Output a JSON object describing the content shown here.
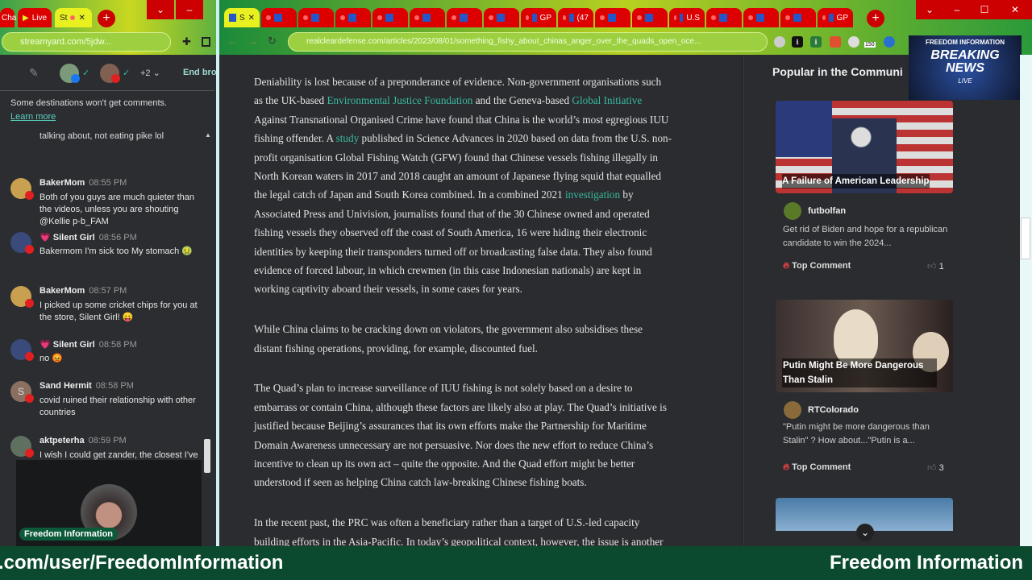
{
  "left_browser": {
    "tabs": [
      {
        "label": "Cha"
      },
      {
        "label": "Live"
      },
      {
        "label": "St"
      }
    ],
    "url": "streamyard.com/5jdw...",
    "toolbar": {
      "destinations_more": "+2",
      "end_broadcast": "End bro"
    }
  },
  "chat": {
    "notice": "Some destinations won't get comments.",
    "learn_more": "Learn more",
    "truncated_top": "talking about, not eating pike lol",
    "messages": [
      {
        "name": "BakerMom",
        "time": "08:55 PM",
        "text": "Both of you guys are much quieter than the videos, unless you are shouting @Kellie p-b_FAM",
        "avatar_color": "#c8a050"
      },
      {
        "name": "💗 Silent Girl",
        "time": "08:56 PM",
        "text": "Bakermom I'm sick too My stomach 🤢",
        "avatar_color": "#3a4a7a"
      },
      {
        "name": "BakerMom",
        "time": "08:57 PM",
        "text": "I picked up some cricket chips for you at the store, Silent Girl! 😛",
        "avatar_color": "#c8a050"
      },
      {
        "name": "💗 Silent Girl",
        "time": "08:58 PM",
        "text": "no 😡",
        "avatar_color": "#3a4a7a"
      },
      {
        "name": "Sand Hermit",
        "time": "08:58 PM",
        "text": "covid ruined their relationship with other countries",
        "avatar_color": "#8a7060",
        "initial": "S"
      },
      {
        "name": "aktpeterha",
        "time": "08:59 PM",
        "text": "I wish I could get zander, the closest I've come to them is looking at my",
        "avatar_color": "#607060"
      }
    ],
    "webcam_label": "Freedom Information"
  },
  "right_browser": {
    "tabs": [
      "S",
      "",
      "",
      "",
      "",
      "",
      "",
      "",
      "GP",
      "(47",
      "",
      "",
      "U.S",
      "",
      "",
      "",
      "GP"
    ],
    "url": "realcleardefense.com/articles/2023/08/01/something_fishy_about_chinas_anger_over_the_quads_open_oce...",
    "extension_badge": "150",
    "window_controls": [
      "⌄",
      "–",
      "☐",
      "✕"
    ]
  },
  "article": {
    "paragraphs": [
      [
        [
          {
            "t": "Deniability is lost because of a preponderance of evidence. Non-government organisations such"
          }
        ],
        [
          {
            "t": "as the UK-based "
          },
          {
            "t": "Environmental Justice Foundation",
            "link": true
          },
          {
            "t": " and the Geneva-based "
          },
          {
            "t": "Global Initiative",
            "link": true
          }
        ],
        [
          {
            "t": "Against Transnational Organised Crime have found that China is the world’s most egregious IUU"
          }
        ],
        [
          {
            "t": "fishing offender. A "
          },
          {
            "t": "study",
            "link": true
          },
          {
            "t": " published in Science Advances in 2020 based on data from the U.S. non-"
          }
        ],
        [
          {
            "t": "profit organisation Global Fishing Watch (GFW) found that Chinese vessels fishing illegally in"
          }
        ],
        [
          {
            "t": "North Korean waters in 2017 and 2018 caught an amount of Japanese flying squid that equalled"
          }
        ],
        [
          {
            "t": "the legal catch of Japan and South Korea combined. In a combined 2021 "
          },
          {
            "t": "investigation",
            "link": true
          },
          {
            "t": " by"
          }
        ],
        [
          {
            "t": "Associated Press and Univision, journalists found that of the 30 Chinese owned and operated"
          }
        ],
        [
          {
            "t": "fishing vessels they observed off the coast of South America, 16 were hiding their electronic"
          }
        ],
        [
          {
            "t": "identities by keeping their transponders turned off or broadcasting false data. They also found"
          }
        ],
        [
          {
            "t": "evidence of forced labour, in which crewmen (in this case Indonesian nationals) are kept in"
          }
        ],
        [
          {
            "t": "working captivity aboard their vessels, in some cases for years."
          }
        ]
      ],
      [
        [
          {
            "t": "While China claims to be cracking down on violators, the government also subsidises these"
          }
        ],
        [
          {
            "t": "distant fishing operations, providing, for example, discounted fuel."
          }
        ]
      ],
      [
        [
          {
            "t": "The Quad’s plan to increase surveillance of IUU fishing is not solely based on a desire to"
          }
        ],
        [
          {
            "t": "embarrass or contain China, although these factors are likely also at play. The Quad’s initiative is"
          }
        ],
        [
          {
            "t": "justified because Beijing’s assurances that its own efforts make the Partnership for Maritime"
          }
        ],
        [
          {
            "t": "Domain Awareness unnecessary are not persuasive. Nor does the new effort to reduce China’s"
          }
        ],
        [
          {
            "t": "incentive to clean up its own act – quite the opposite. And the Quad effort might be better"
          }
        ],
        [
          {
            "t": "understood if seen as helping China catch law-breaking Chinese fishing boats."
          }
        ]
      ],
      [
        [
          {
            "t": "In the recent past, the PRC was often a beneficiary rather than a target of U.S.-led capacity"
          }
        ],
        [
          {
            "t": "building efforts in the Asia-Pacific. In today’s geopolitical context, however, the issue is another"
          }
        ]
      ]
    ]
  },
  "sidebar": {
    "heading": "Popular in the Communi",
    "overlay": {
      "top": "FREEDOM INFORMATION",
      "main1": "BREAKING",
      "main2": "NEWS",
      "sub": "LIVE"
    },
    "cards": [
      {
        "title": "A Failure of American Leadership",
        "user": "futbolfan",
        "comment": "Get rid of Biden and hope for a republican candidate to win the 2024...",
        "tag": "Top Comment",
        "likes": "1"
      },
      {
        "title": "Putin Might Be More Dangerous Than Stalin",
        "user": "RTColorado",
        "comment": "\"Putin might be more dangerous than Stalin\" ? How about...\"Putin is a...",
        "tag": "Top Comment",
        "likes": "3"
      }
    ]
  },
  "banner": {
    "left": ".com/user/FreedomInformation",
    "right": "Freedom Information"
  },
  "colors": {
    "link": "#3ab8a0",
    "banner": "#0b4a2e",
    "tab_red": "#dd0000"
  }
}
